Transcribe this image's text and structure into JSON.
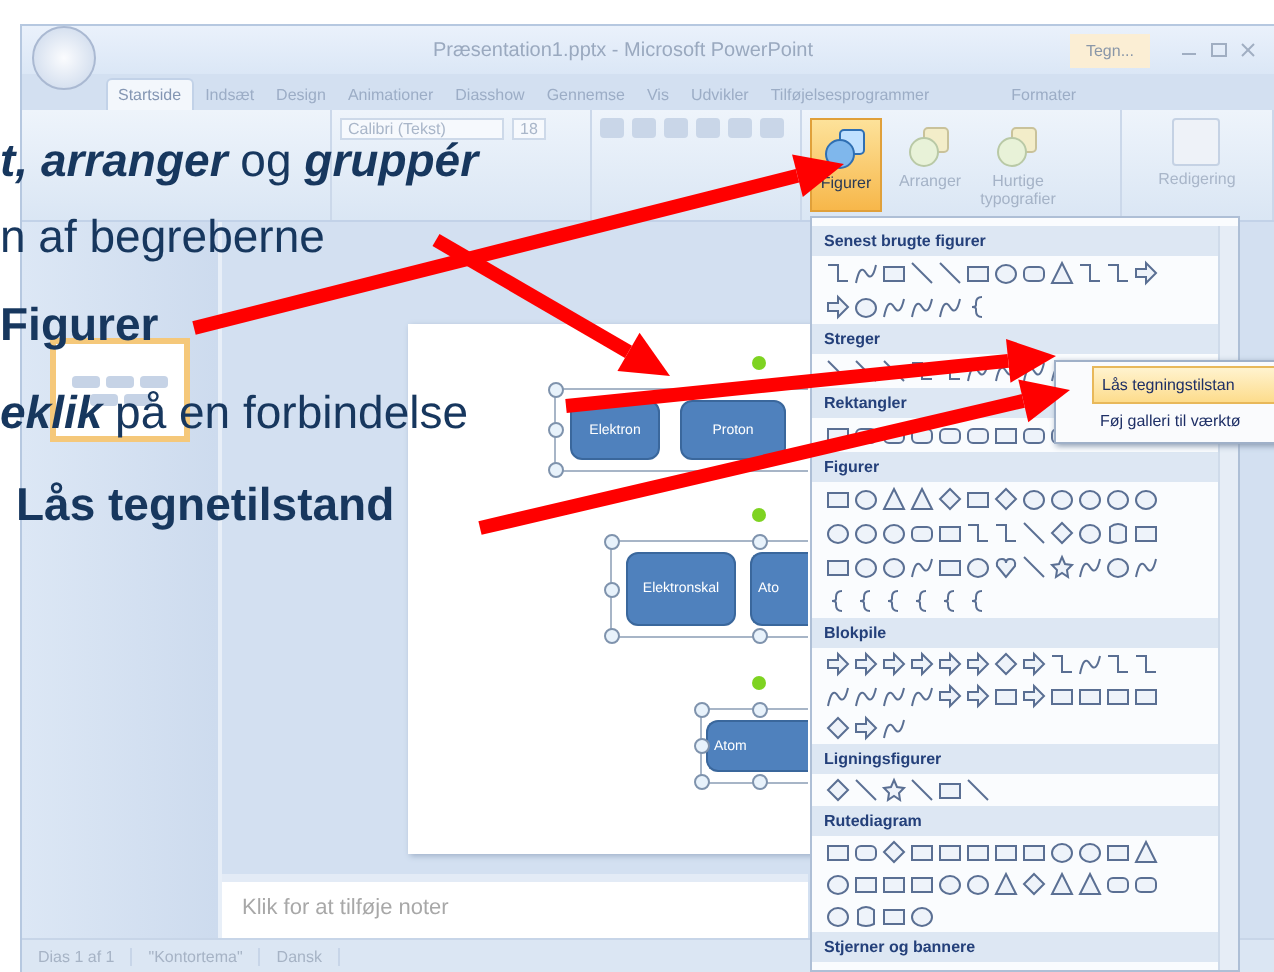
{
  "window": {
    "title": "Præsentation1.pptx - Microsoft PowerPoint",
    "context_tab": "Tegn..."
  },
  "tabs": [
    {
      "label": "Startside",
      "selected": true
    },
    {
      "label": "Indsæt",
      "selected": false
    },
    {
      "label": "Design",
      "selected": false
    },
    {
      "label": "Animationer",
      "selected": false
    },
    {
      "label": "Diasshow",
      "selected": false
    },
    {
      "label": "Gennemse",
      "selected": false
    },
    {
      "label": "Vis",
      "selected": false
    },
    {
      "label": "Udvikler",
      "selected": false
    },
    {
      "label": "Tilføjelsesprogrammer",
      "selected": false
    },
    {
      "label": "Formater",
      "selected": false
    }
  ],
  "ribbon": {
    "font_name": "Calibri (Tekst)",
    "font_size": "18",
    "editing_label": "Redigering",
    "drawing_buttons": [
      {
        "label": "Figurer",
        "selected": true
      },
      {
        "label": "Arranger",
        "selected": false
      },
      {
        "label": "Hurtige typografier",
        "selected": false
      }
    ]
  },
  "slide": {
    "groups": [
      {
        "boxes": [
          "Elektron",
          "Proton"
        ]
      },
      {
        "boxes": [
          "Elektronskal",
          "Ato"
        ]
      },
      {
        "boxes": [
          "Atom"
        ]
      }
    ]
  },
  "notes": {
    "placeholder": "Klik for at tilføje noter"
  },
  "status_bar": [
    "Dias 1 af 1",
    "\"Kontortema\"",
    "Dansk"
  ],
  "gallery": {
    "sections": [
      "Senest brugte figurer",
      "Streger",
      "Rektangler",
      "Figurer",
      "Blokpile",
      "Ligningsfigurer",
      "Rutediagram",
      "Stjerner og bannere"
    ]
  },
  "context_menu": [
    {
      "label": "Lås tegningstilstan",
      "selected": true
    },
    {
      "label": "Føj galleri til værktø",
      "selected": false
    }
  ],
  "annotations": [
    {
      "text": "**t, arranger** og **gruppér**",
      "kind": "plain"
    },
    {
      "text": "n af begreberne",
      "kind": "plain"
    },
    {
      "text": "Figurer",
      "kind": "bold"
    },
    {
      "text": "**eklik** på en forbindelse",
      "kind": "plain"
    },
    {
      "text": "Lås tegnetilstand",
      "kind": "bold"
    }
  ]
}
